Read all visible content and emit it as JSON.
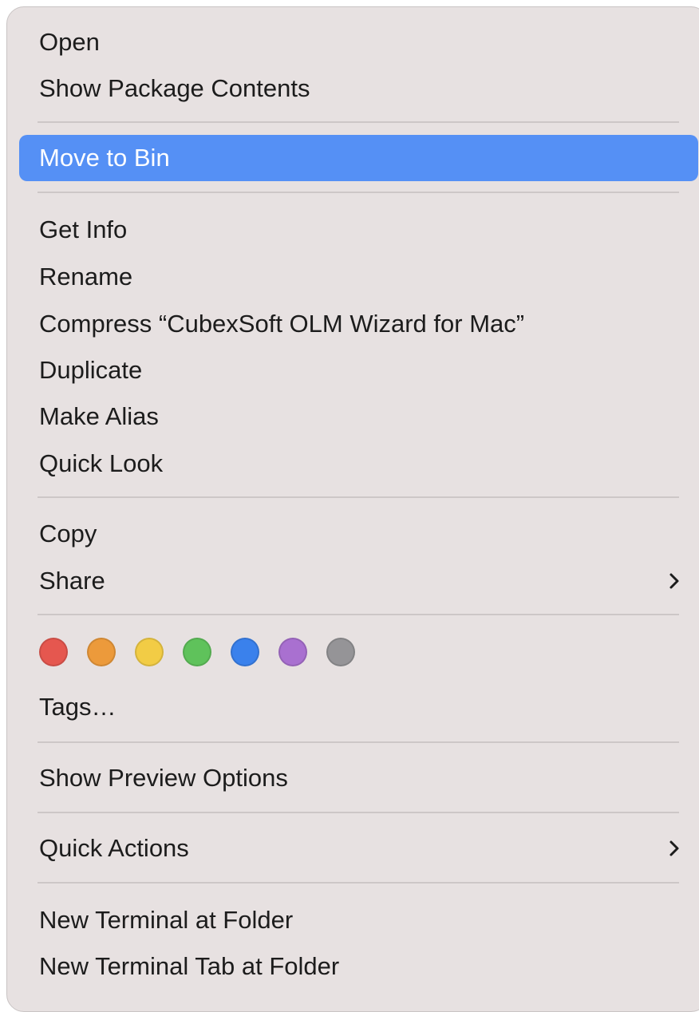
{
  "menu": {
    "group_open": [
      {
        "label": "Open"
      },
      {
        "label": "Show Package Contents"
      }
    ],
    "move_to_bin": {
      "label": "Move to Bin"
    },
    "group_file": [
      {
        "label": "Get Info"
      },
      {
        "label": "Rename"
      },
      {
        "label": "Compress “CubexSoft OLM Wizard for Mac”"
      },
      {
        "label": "Duplicate"
      },
      {
        "label": "Make Alias"
      },
      {
        "label": "Quick Look"
      }
    ],
    "copy": {
      "label": "Copy"
    },
    "share": {
      "label": "Share",
      "icon": "chevron-right-icon"
    },
    "tag_colors": [
      {
        "name": "red",
        "color": "#e5574f"
      },
      {
        "name": "orange",
        "color": "#ec9a3b"
      },
      {
        "name": "yellow",
        "color": "#f2cc45"
      },
      {
        "name": "green",
        "color": "#5fc25b"
      },
      {
        "name": "blue",
        "color": "#3a81ec"
      },
      {
        "name": "purple",
        "color": "#a970d0"
      },
      {
        "name": "gray",
        "color": "#959497"
      }
    ],
    "tags": {
      "label": "Tags…"
    },
    "show_preview_options": {
      "label": "Show Preview Options"
    },
    "quick_actions": {
      "label": "Quick Actions",
      "icon": "chevron-right-icon"
    },
    "group_terminal": [
      {
        "label": "New Terminal at Folder"
      },
      {
        "label": "New Terminal Tab at Folder"
      }
    ],
    "highlight_color": "#5590f5",
    "background_color": "#e7e1e1"
  }
}
